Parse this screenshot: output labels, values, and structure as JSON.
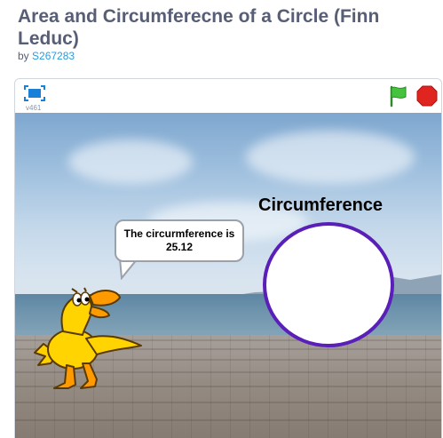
{
  "project": {
    "title": "Area and Circumferecne of a Circle (Finn Leduc)",
    "by_label": "by",
    "author": "S267283"
  },
  "player": {
    "version": "v461",
    "icons": {
      "fullscreen": "fullscreen-icon",
      "green_flag": "green-flag-icon",
      "stop": "stop-icon"
    },
    "colors": {
      "flag": "#45c33d",
      "stop": "#e0241f",
      "fullscreen": "#1a7fd6"
    }
  },
  "stage": {
    "circle_label": "Circumference",
    "circle_border_color": "#5a1fb8",
    "speech": "The circurmference is 25.12",
    "sprite": "duck"
  }
}
